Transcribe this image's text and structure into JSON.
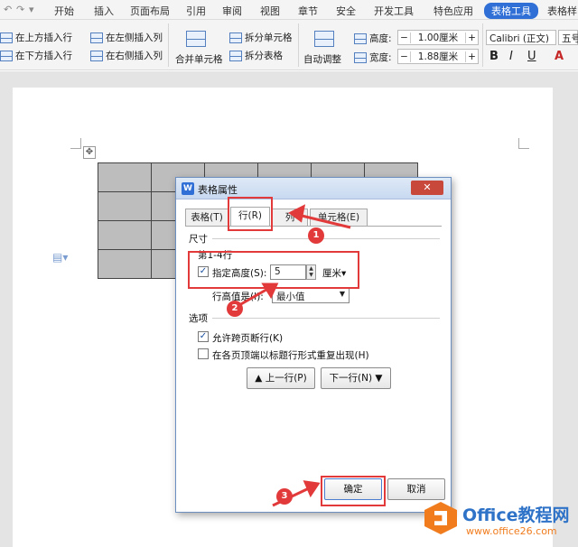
{
  "menubar": {
    "quick_access": [
      "↶",
      "↷",
      "▾"
    ],
    "items": [
      "开始",
      "插入",
      "页面布局",
      "引用",
      "审阅",
      "视图",
      "章节",
      "安全",
      "开发工具",
      "特色应用",
      "表格工具",
      "表格样"
    ]
  },
  "ribbon": {
    "insert_above": "在上方插入行",
    "insert_left": "在左侧插入列",
    "insert_below": "在下方插入行",
    "insert_right": "在右侧插入列",
    "merge_cells": "合并单元格",
    "split_cells": "拆分单元格",
    "split_table": "拆分表格",
    "auto_fit": "自动调整",
    "height_label": "高度:",
    "height_value": "1.00厘米",
    "width_label": "宽度:",
    "width_value": "1.88厘米",
    "font_name": "Calibri (正文)",
    "font_size": "五号",
    "minus": "−",
    "plus": "+",
    "bold": "B",
    "italic": "I",
    "underline": "U",
    "font_color": "A"
  },
  "dialog": {
    "title": "表格属性",
    "close": "✕",
    "tabs": [
      "表格(T)",
      "行(R)",
      "列",
      "单元格(E)"
    ],
    "size_section": "尺寸",
    "rows_label": "第1-4行",
    "specify_height": "指定高度(S):",
    "height_value": "5",
    "height_unit": "厘米▾",
    "row_height_is": "行高值是(I):",
    "row_height_mode": "最小值",
    "options_section": "选项",
    "allow_break": "允许跨页断行(K)",
    "repeat_header": "在各页顶端以标题行形式重复出现(H)",
    "prev_row": "▲ 上一行(P)",
    "next_row": "下一行(N) ▼",
    "ok": "确定",
    "cancel": "取消"
  },
  "annotations": {
    "badges": [
      "1",
      "2",
      "3"
    ],
    "color": "#e23a3a"
  },
  "watermark": {
    "title": "Office教程网",
    "url": "www.office26.com"
  }
}
